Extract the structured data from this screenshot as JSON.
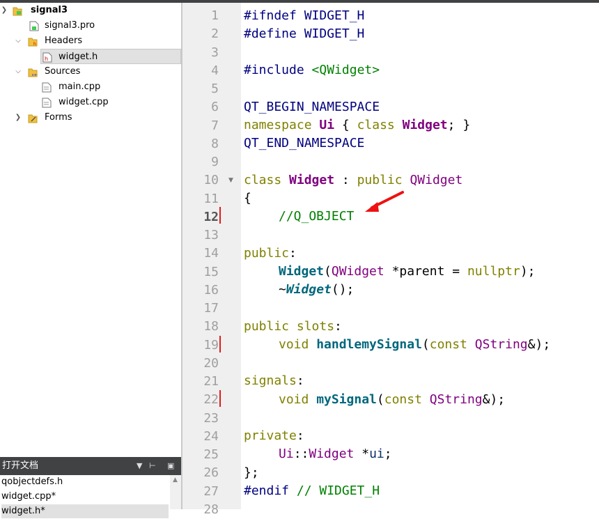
{
  "project_tree": {
    "project": "signal3",
    "pro_file": "signal3.pro",
    "headers_folder": "Headers",
    "header_file": "widget.h",
    "sources_folder": "Sources",
    "source_files": [
      "main.cpp",
      "widget.cpp"
    ],
    "forms_folder": "Forms"
  },
  "open_documents": {
    "title": "打开文档",
    "items": [
      "qobjectdefs.h",
      "widget.cpp*",
      "widget.h*"
    ]
  },
  "editor": {
    "current_line": 12,
    "lines": [
      {
        "n": "1"
      },
      {
        "n": "2"
      },
      {
        "n": "3"
      },
      {
        "n": "4"
      },
      {
        "n": "5"
      },
      {
        "n": "6"
      },
      {
        "n": "7"
      },
      {
        "n": "8"
      },
      {
        "n": "9"
      },
      {
        "n": "10"
      },
      {
        "n": "11"
      },
      {
        "n": "12"
      },
      {
        "n": "13"
      },
      {
        "n": "14"
      },
      {
        "n": "15"
      },
      {
        "n": "16"
      },
      {
        "n": "17"
      },
      {
        "n": "18"
      },
      {
        "n": "19"
      },
      {
        "n": "20"
      },
      {
        "n": "21"
      },
      {
        "n": "22"
      },
      {
        "n": "23"
      },
      {
        "n": "24"
      },
      {
        "n": "25"
      },
      {
        "n": "26"
      },
      {
        "n": "27"
      },
      {
        "n": "28"
      }
    ],
    "tokens": {
      "l1": "#ifndef WIDGET_H",
      "l2": "#define WIDGET_H",
      "l4a": "#include ",
      "l4b": "<QWidget>",
      "l6": "QT_BEGIN_NAMESPACE",
      "l7a": "namespace ",
      "l7b": "Ui",
      "l7c": " { ",
      "l7d": "class ",
      "l7e": "Widget",
      "l7f": "; }",
      "l8": "QT_END_NAMESPACE",
      "l10a": "class ",
      "l10b": "Widget",
      "l10c": " : ",
      "l10d": "public ",
      "l10e": "QWidget",
      "l11": "{",
      "l12": "//Q_OBJECT",
      "l14a": "public",
      "l14b": ":",
      "l15a": "Widget",
      "l15b": "(",
      "l15c": "QWidget",
      "l15d": " *parent = ",
      "l15e": "nullptr",
      "l15f": ");",
      "l16a": "~",
      "l16b": "Widget",
      "l16c": "();",
      "l18a": "public slots",
      "l18b": ":",
      "l19a": "void ",
      "l19b": "handlemySignal",
      "l19c": "(",
      "l19d": "const ",
      "l19e": "QString",
      "l19f": "&);",
      "l21a": "signals",
      "l21b": ":",
      "l22a": "void ",
      "l22b": "mySignal",
      "l22c": "(",
      "l22d": "const ",
      "l22e": "QString",
      "l22f": "&);",
      "l24a": "private",
      "l24b": ":",
      "l25a": "Ui",
      "l25b": "::",
      "l25c": "Widget",
      "l25d": " *",
      "l25e": "ui",
      "l25f": ";",
      "l26": "};",
      "l27a": "#endif ",
      "l27b": "// WIDGET_H"
    }
  },
  "colors": {
    "keyword": "#808000",
    "type": "#800080",
    "preprocessor": "#000080",
    "comment": "#008000",
    "function": "#00677c",
    "change_marker": "#e41a1a",
    "dock_header": "#404244"
  }
}
